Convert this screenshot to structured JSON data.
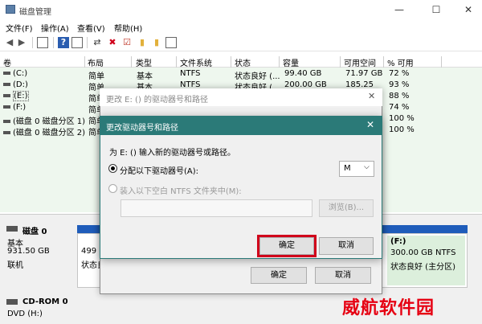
{
  "window": {
    "title": "磁盘管理",
    "min": "—",
    "max": "☐",
    "close": "✕"
  },
  "menu": [
    "文件(F)",
    "操作(A)",
    "查看(V)",
    "帮助(H)"
  ],
  "columns": [
    "卷",
    "布局",
    "类型",
    "文件系统",
    "状态",
    "容量",
    "可用空间",
    "% 可用"
  ],
  "volumes": [
    {
      "name": "(C:)",
      "layout": "简单",
      "type": "基本",
      "fs": "NTFS",
      "status": "状态良好 (...",
      "cap": "99.40 GB",
      "free": "71.97 GB",
      "pct": "72 %"
    },
    {
      "name": "(D:)",
      "layout": "简单",
      "type": "基本",
      "fs": "NTFS",
      "status": "状态良好 (...",
      "cap": "200.00 GB",
      "free": "185.25",
      "pct": "93 %"
    },
    {
      "name": "(E:)",
      "layout": "简单",
      "type": "",
      "fs": "",
      "status": "",
      "cap": "",
      "free": "",
      "pct": "88 %"
    },
    {
      "name": "(F:)",
      "layout": "简单",
      "type": "",
      "fs": "",
      "status": "",
      "cap": "",
      "free": "",
      "pct": "74 %"
    },
    {
      "name": "(磁盘 0 磁盘分区 1)",
      "layout": "简单",
      "type": "",
      "fs": "",
      "status": "",
      "cap": "",
      "free": "",
      "pct": "100 %"
    },
    {
      "name": "(磁盘 0 磁盘分区 2)",
      "layout": "简单",
      "type": "",
      "fs": "",
      "status": "",
      "cap": "",
      "free": "",
      "pct": "100 %"
    }
  ],
  "disk0": {
    "name": "磁盘 0",
    "type": "基本",
    "size": "931.50 GB",
    "state": "联机",
    "part_left_1": "499 ",
    "part_left_2": "状态良",
    "part_f_name": "(F:)",
    "part_f_size": "300.00 GB NTFS",
    "part_f_status": "状态良好 (主分区)"
  },
  "cdrom": {
    "name": "CD-ROM 0",
    "drive": "DVD (H:)"
  },
  "outer_dialog": {
    "title": "更改 E: () 的驱动器号和路径",
    "ok": "确定",
    "cancel": "取消"
  },
  "dialog": {
    "title": "更改驱动器号和路径",
    "prompt": "为 E: () 输入新的驱动器号或路径。",
    "option_letter": "分配以下驱动器号(A):",
    "letter_value": "M",
    "option_folder": "装入以下空白 NTFS 文件夹中(M):",
    "browse": "浏览(B)...",
    "ok": "确定",
    "cancel": "取消"
  },
  "watermark": "威航软件园",
  "colors": {
    "dialog_title": "#2b7a78",
    "ok_highlight": "#d0021b",
    "partition_stripe": "#1f5cba",
    "volume_bg": "#eef7ee"
  }
}
